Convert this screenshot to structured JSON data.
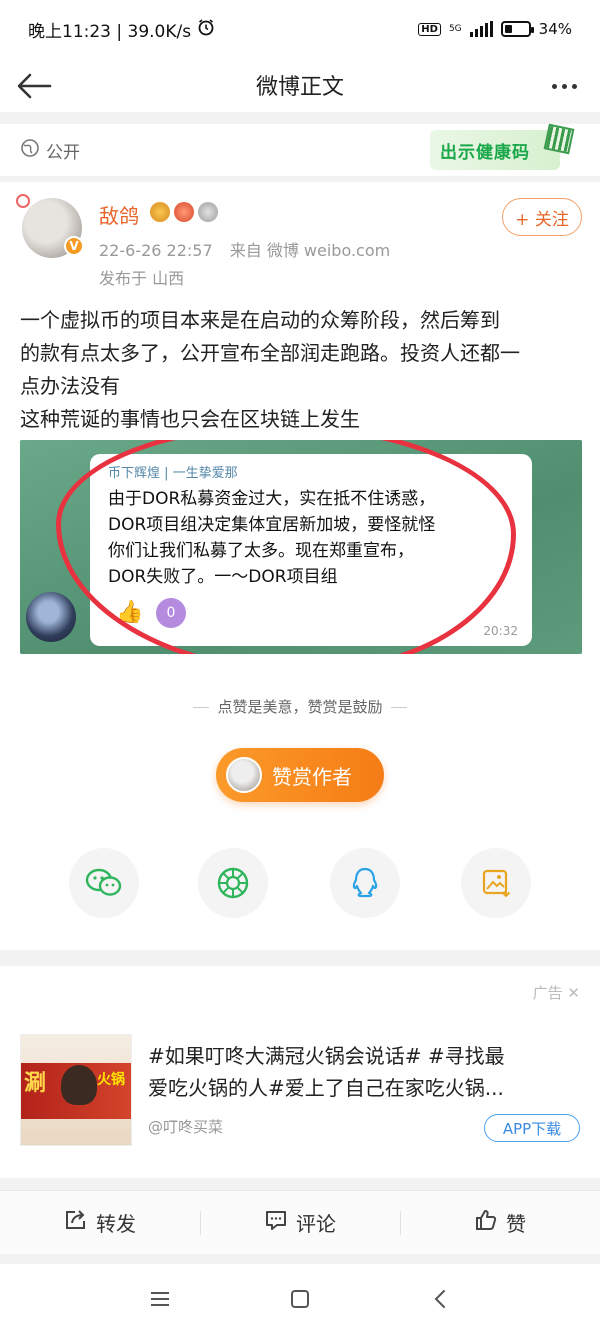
{
  "status_bar": {
    "time_speed": "晚上11:23 | 39.0K/s",
    "network_label": "HD",
    "network_gen": "5G",
    "battery_level": 34,
    "battery_text": "34%"
  },
  "nav": {
    "title": "微博正文"
  },
  "visibility": {
    "label": "公开",
    "health_code_label": "出示健康码"
  },
  "post": {
    "username": "敌鸽",
    "time": "22-6-26 22:57",
    "source": "来自 微博 weibo.com",
    "location": "发布于 山西",
    "follow_label": "+ 关注",
    "text_lines": [
      "一个虚拟币的项目本来是在启动的众筹阶段，然后筹到",
      "的款有点太多了，公开宣布全部润走跑路。投资人还都一",
      "点办法没有",
      "这种荒诞的事情也只会在区块链上发生"
    ],
    "image": {
      "sender": "币下辉煌 | 一生挚爱那",
      "message_lines": [
        "由于DOR私募资金过大，实在抵不住诱惑，",
        "DOR项目组决定集体宜居新加坡，要怪就怪",
        "你们让我们私募了太多。现在郑重宣布，",
        "DOR失败了。一～DOR项目组"
      ],
      "reaction_count": "0",
      "time": "20:32"
    }
  },
  "reward": {
    "hint": "点赞是美意，赞赏是鼓励",
    "button_label": "赞赏作者"
  },
  "share_icons": [
    "wechat-icon",
    "moments-icon",
    "qq-icon",
    "save-image-icon"
  ],
  "ad": {
    "tag": "广告",
    "thumb_text_left": "涮",
    "thumb_text_right": "火锅",
    "title_line1": "#如果叮咚大满冠火锅会说话# #寻找最",
    "title_line2": "爱吃火锅的人#爱上了自己在家吃火锅...",
    "source": "@叮咚买菜",
    "download_label": "APP下载"
  },
  "actions": {
    "repost": "转发",
    "comment": "评论",
    "like": "赞"
  },
  "colors": {
    "accent": "#e8662a",
    "reward": "#f57c16",
    "link_blue": "#3a8be0"
  }
}
